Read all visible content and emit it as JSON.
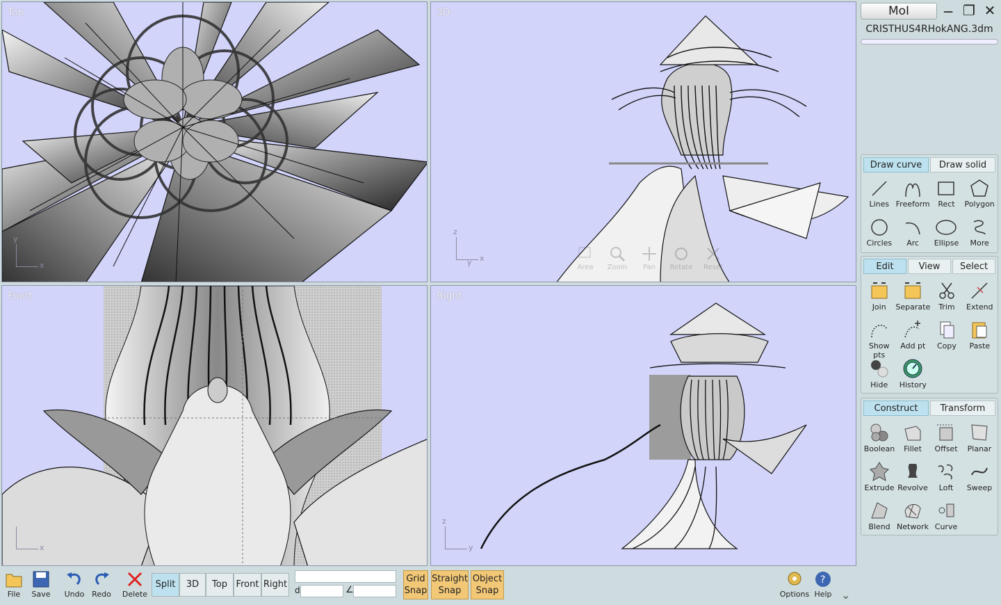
{
  "app": {
    "title": "MoI",
    "filename": "CRISTHUS4RHokANG.3dm"
  },
  "viewports": {
    "top": {
      "label": "Top",
      "axis_v": "y",
      "axis_h": "x"
    },
    "3d": {
      "label": "3D",
      "axis_v": "z",
      "axis_h": "x",
      "axis_d": "y"
    },
    "front": {
      "label": "Front",
      "axis_v": "",
      "axis_h": "x"
    },
    "right": {
      "label": "Right",
      "axis_v": "z",
      "axis_h": "y"
    }
  },
  "view_nav": [
    "Area",
    "Zoom",
    "Pan",
    "Rotate",
    "Reset"
  ],
  "draw_group": {
    "tabs": [
      "Draw curve",
      "Draw solid"
    ],
    "tools": [
      "Lines",
      "Freeform",
      "Rect",
      "Polygon",
      "Circles",
      "Arc",
      "Ellipse",
      "More"
    ]
  },
  "edit_group": {
    "tabs": [
      "Edit",
      "View",
      "Select"
    ],
    "tools": [
      "Join",
      "Separate",
      "Trim",
      "Extend",
      "Show pts",
      "Add pt",
      "Copy",
      "Paste",
      "Hide",
      "History"
    ]
  },
  "construct_group": {
    "tabs": [
      "Construct",
      "Transform"
    ],
    "tools": [
      "Boolean",
      "Fillet",
      "Offset",
      "Planar",
      "Extrude",
      "Revolve",
      "Loft",
      "Sweep",
      "Blend",
      "Network",
      "Curve"
    ]
  },
  "bottom": {
    "file": "File",
    "save": "Save",
    "undo": "Undo",
    "redo": "Redo",
    "delete": "Delete",
    "views": [
      "Split",
      "3D",
      "Top",
      "Front",
      "Right"
    ],
    "d_label": "d",
    "angle_label": "∠",
    "grid_snap": [
      "Grid",
      "Snap"
    ],
    "straight_snap": [
      "Straight",
      "Snap"
    ],
    "object_snap": [
      "Object",
      "Snap"
    ],
    "options": "Options",
    "help": "Help"
  }
}
